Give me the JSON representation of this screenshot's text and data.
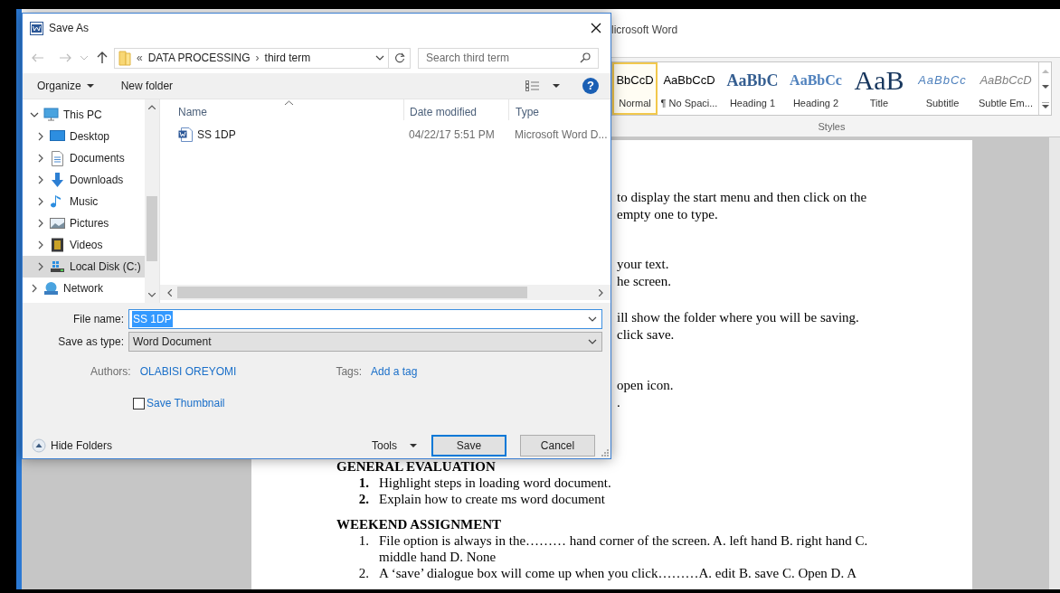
{
  "word_window": {
    "title": "licrosoft Word",
    "styles": [
      {
        "kind": "normal",
        "preview": "BbCcD",
        "label": "Normal",
        "selected": true
      },
      {
        "kind": "plain",
        "preview": "AaBbCcD",
        "label": "¶ No Spaci...",
        "selected": false
      },
      {
        "kind": "heading1",
        "preview": "AaBbC",
        "label": "Heading 1",
        "selected": false
      },
      {
        "kind": "heading2",
        "preview": "AaBbCc",
        "label": "Heading 2",
        "selected": false
      },
      {
        "kind": "title",
        "preview": "AaB",
        "label": "Title",
        "selected": false
      },
      {
        "kind": "subtitle",
        "preview": "AaBbCc",
        "label": "Subtitle",
        "selected": false
      },
      {
        "kind": "subtle",
        "preview": "AaBbCcD",
        "label": "Subtle Em...",
        "selected": false
      }
    ],
    "styles_group_label": "Styles",
    "document": {
      "fragments": [
        [
          "to display the start menu and then click on the",
          "empty one to type."
        ],
        [
          "your text.",
          "he screen."
        ],
        [
          "ill show the folder where you will be saving.",
          "click save."
        ],
        [
          "open icon.",
          "."
        ]
      ],
      "sections": [
        {
          "heading": "GENERAL EVALUATION",
          "bold_numbers": true,
          "items": [
            {
              "number": "1.",
              "text": "Highlight steps in loading word document."
            },
            {
              "number": "2.",
              "text": "Explain how to create ms word document"
            }
          ]
        },
        {
          "heading": "WEEKEND ASSIGNMENT",
          "bold_numbers": false,
          "items": [
            {
              "number": "1.",
              "text": "File option is always in the……… hand corner of the screen. A. left hand B. right hand C. middle hand D. None"
            },
            {
              "number": "2.",
              "text": "A ‘save’ dialogue box will come up when you click………A. edit B. save C. Open D. A"
            }
          ]
        }
      ]
    }
  },
  "dialog": {
    "title": "Save As",
    "address": {
      "prefix": "«",
      "separator": "›",
      "segments": [
        "DATA PROCESSING",
        "third term"
      ]
    },
    "search": {
      "placeholder": "Search third term"
    },
    "toolbar": {
      "organize": "Organize",
      "new_folder": "New folder",
      "help": "?"
    },
    "nav_tree": [
      {
        "kind": "pc",
        "label": "This PC",
        "expanded": true,
        "selected": false,
        "children": [
          {
            "kind": "desktop",
            "label": "Desktop",
            "expanded": false,
            "selected": false
          },
          {
            "kind": "documents",
            "label": "Documents",
            "expanded": false,
            "selected": false
          },
          {
            "kind": "downloads",
            "label": "Downloads",
            "expanded": false,
            "selected": false
          },
          {
            "kind": "music",
            "label": "Music",
            "expanded": false,
            "selected": false
          },
          {
            "kind": "pictures",
            "label": "Pictures",
            "expanded": false,
            "selected": false
          },
          {
            "kind": "videos",
            "label": "Videos",
            "expanded": false,
            "selected": false
          },
          {
            "kind": "disk",
            "label": "Local Disk (C:)",
            "expanded": false,
            "selected": true
          }
        ]
      },
      {
        "kind": "network",
        "label": "Network",
        "expanded": false,
        "selected": false
      }
    ],
    "columns": [
      "Name",
      "Date modified",
      "Type"
    ],
    "files": [
      {
        "name": "SS 1DP",
        "date_modified": "04/22/17 5:51 PM",
        "type": "Microsoft Word D..."
      }
    ],
    "file_name_label": "File name:",
    "file_name": "SS 1DP",
    "save_as_type_label": "Save as type:",
    "save_as_type": "Word Document",
    "authors_label": "Authors:",
    "authors": "OLABISI OREYOMI",
    "tags_label": "Tags:",
    "tags": "Add a tag",
    "save_thumbnail": {
      "label": "Save Thumbnail",
      "checked": false
    },
    "hide_folders": "Hide Folders",
    "tools": "Tools",
    "buttons": [
      {
        "label": "Save",
        "default": true
      },
      {
        "label": "Cancel",
        "default": false
      }
    ]
  }
}
